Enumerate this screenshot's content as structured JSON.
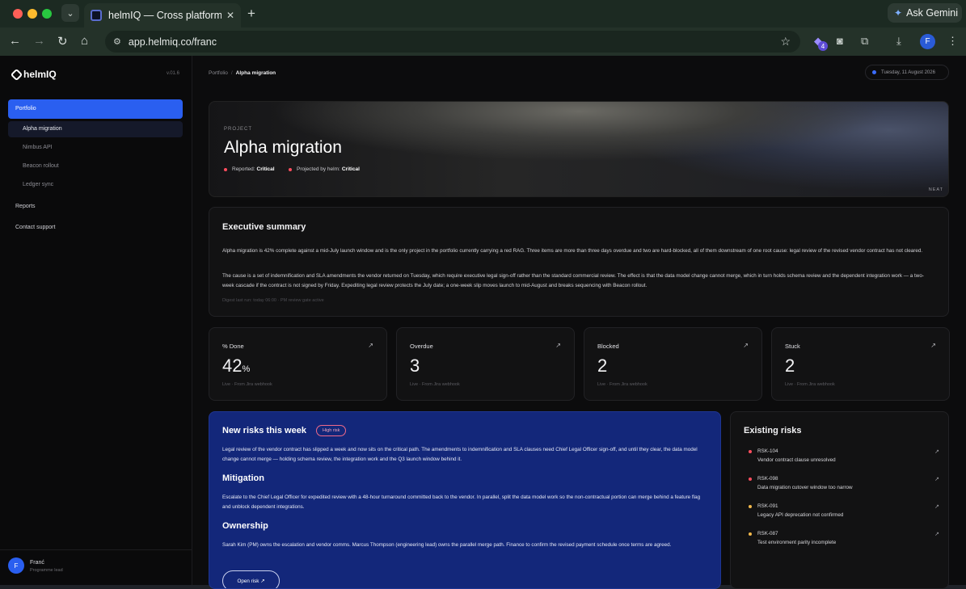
{
  "browser": {
    "tab_title": "helmIQ — Cross platform intel",
    "url": "app.helmiq.co/franc",
    "ask_gemini": "Ask Gemini",
    "extension_badge": "4",
    "profile_initial": "F"
  },
  "sidebar": {
    "brand": "helmIQ",
    "version": "v.01.6",
    "portfolio_label": "Portfolio",
    "projects": [
      "Alpha migration",
      "Nimbus API",
      "Beacon rollout",
      "Ledger sync"
    ],
    "reports_label": "Reports",
    "support_label": "Contact support",
    "user": {
      "initial": "F",
      "name": "Franć",
      "role": "Programme lead"
    }
  },
  "header": {
    "breadcrumb_root": "Portfolio",
    "breadcrumb_sep": "/",
    "breadcrumb_current": "Alpha migration",
    "date": "Tuesday, 11 August 2026"
  },
  "hero": {
    "kicker": "PROJECT",
    "title": "Alpha migration",
    "reported_label": "Reported:",
    "reported_value": "Critical",
    "projected_label": "Projected by helm:",
    "projected_value": "Critical",
    "tag": "NEAT"
  },
  "summary": {
    "title": "Executive summary",
    "p1": "Alpha migration is 42% complete against a mid-July launch window and is the only project in the portfolio currently carrying a red RAG. Three items are more than three days overdue and two are hard-blocked, all of them downstream of one root cause: legal review of the revised vendor contract has not cleared.",
    "p2": "The cause is a set of indemnification and SLA amendments the vendor returned on Tuesday, which require executive legal sign-off rather than the standard commercial review. The effect is that the data model change cannot merge, which in turn holds schema review and the dependent integration work — a two-week cascade if the contract is not signed by Friday. Expediting legal review protects the July date; a one-week slip moves launch to mid-August and breaks sequencing with Beacon rollout.",
    "digest": "Digest last run: today 06:00 · PM review gate active"
  },
  "stats": [
    {
      "label": "% Done",
      "value": "42",
      "unit": "%",
      "source": "Live · From Jira webhook"
    },
    {
      "label": "Overdue",
      "value": "3",
      "unit": "",
      "source": "Live · From Jira webhook"
    },
    {
      "label": "Blocked",
      "value": "2",
      "unit": "",
      "source": "Live · From Jira webhook"
    },
    {
      "label": "Stuck",
      "value": "2",
      "unit": "",
      "source": "Live · From Jira webhook"
    }
  ],
  "new_risks": {
    "title": "New risks this week",
    "badge": "High risk",
    "body": "Legal review of the vendor contract has slipped a week and now sits on the critical path. The amendments to indemnification and SLA clauses need Chief Legal Officer sign-off, and until they clear, the data model change cannot merge — holding schema review, the integration work and the Q3 launch window behind it.",
    "mitigation_title": "Mitigation",
    "mitigation": "Escalate to the Chief Legal Officer for expedited review with a 48-hour turnaround committed back to the vendor. In parallel, split the data model work so the non-contractual portion can merge behind a feature flag and unblock dependent integrations.",
    "ownership_title": "Ownership",
    "ownership": "Sarah Kim (PM) owns the escalation and vendor comms. Marcus Thompson (engineering lead) owns the parallel merge path. Finance to confirm the revised payment schedule once terms are agreed.",
    "button": "Open risk ↗"
  },
  "existing_risks": {
    "title": "Existing risks",
    "items": [
      {
        "id": "RSK-104",
        "desc": "Vendor contract clause unresolved",
        "color": "#ff4d5e"
      },
      {
        "id": "RSK-098",
        "desc": "Data migration cutover window too narrow",
        "color": "#ff4d5e"
      },
      {
        "id": "RSK-091",
        "desc": "Legacy API deprecation not confirmed",
        "color": "#f2b84b"
      },
      {
        "id": "RSK-087",
        "desc": "Test environment parity incomplete",
        "color": "#f2b84b"
      }
    ]
  },
  "colors": {
    "accent": "#2a5ff0",
    "critical": "#ff4d5e",
    "warning": "#f2b84b",
    "risk_panel": "#13277a"
  }
}
